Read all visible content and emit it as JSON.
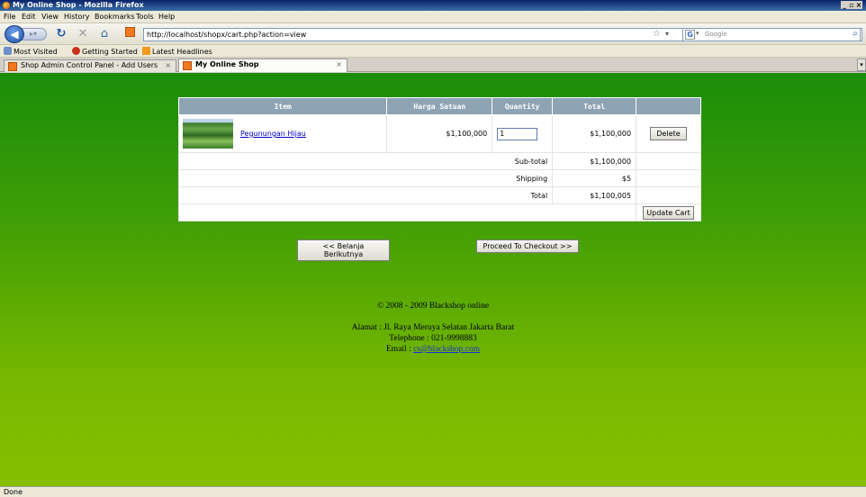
{
  "window": {
    "title": "My Online Shop - Mozilla Firefox",
    "controls": [
      "_",
      "▫",
      "×"
    ]
  },
  "menu": [
    "File",
    "Edit",
    "View",
    "History",
    "Bookmarks",
    "Tools",
    "Help"
  ],
  "nav": {
    "url": "http://localhost/shopx/cart.php?action=view",
    "search_placeholder": "Google"
  },
  "bookmarks": [
    "Most Visited",
    "Getting Started",
    "Latest Headlines"
  ],
  "tabs": [
    {
      "label": "Shop Admin Control Panel - Add Users",
      "close": "×"
    },
    {
      "label": "My Online Shop",
      "close": "×"
    }
  ],
  "cart": {
    "headers": {
      "item": "Item",
      "unit_price": "Harga Satuan",
      "quantity": "Quantity",
      "total": "Total"
    },
    "items": [
      {
        "name": "Pegunungan Hijau",
        "unit_price": "$1,100,000",
        "quantity": "1",
        "total": "$1,100,000",
        "delete_label": "Delete"
      }
    ],
    "subtotal_label": "Sub-total",
    "subtotal_value": "$1,100,000",
    "shipping_label": "Shipping",
    "shipping_value": "$5",
    "total_label": "Total",
    "total_value": "$1,100,005",
    "update_label": "Update Cart"
  },
  "buttons": {
    "continue": "<< Belanja Berikutnya",
    "checkout": "Proceed To Checkout >>"
  },
  "footer": {
    "copyright": "© 2008 - 2009 Blackshop online",
    "address": "Alamat : Jl. Raya Meruya Selatan Jakarta Barat",
    "phone": "Telephone : 021-9998883",
    "email_label": "Email : ",
    "email": "cs@blackshop.com"
  },
  "status": "Done",
  "colors": {
    "header_bg": "#8ea3b3",
    "page_top": "#1a8d09",
    "page_bottom": "#86bf00",
    "link": "#0000cc"
  }
}
